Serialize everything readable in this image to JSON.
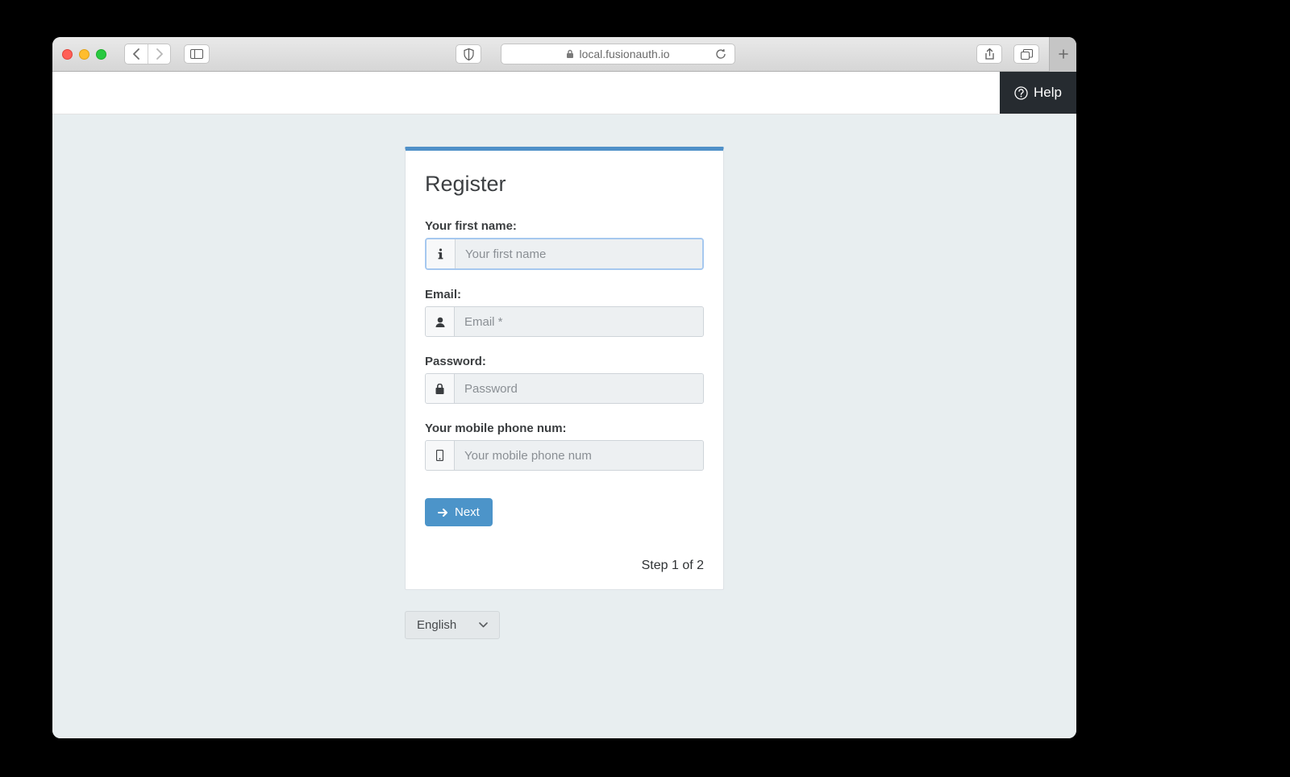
{
  "browser": {
    "url": "local.fusionauth.io"
  },
  "header": {
    "help_label": "Help"
  },
  "register": {
    "title": "Register",
    "fields": {
      "first_name": {
        "label": "Your first name:",
        "placeholder": "Your first name",
        "value": ""
      },
      "email": {
        "label": "Email:",
        "placeholder": "Email *",
        "value": ""
      },
      "password": {
        "label": "Password:",
        "placeholder": "Password",
        "value": ""
      },
      "phone": {
        "label": "Your mobile phone num:",
        "placeholder": "Your mobile phone num",
        "value": ""
      }
    },
    "next_label": "Next",
    "step_text": "Step 1 of 2"
  },
  "footer": {
    "language": "English"
  }
}
